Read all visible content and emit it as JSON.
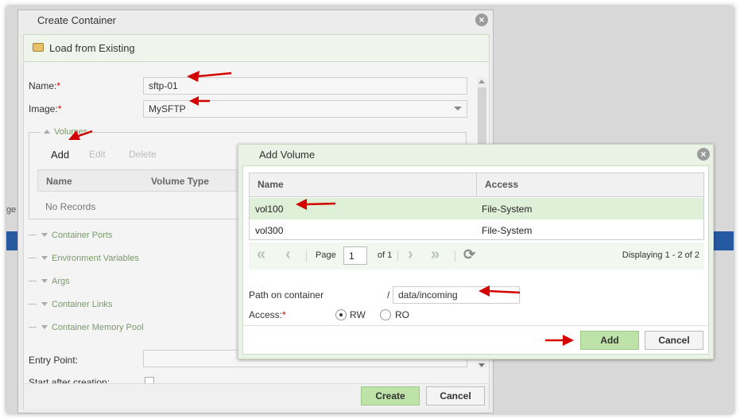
{
  "background": {
    "partial_label": "ge"
  },
  "create_dialog": {
    "title": "Create Container",
    "load_existing": "Load from Existing",
    "name_label": "Name:",
    "name_value": "sftp-01",
    "image_label": "Image:",
    "image_value": "MySFTP",
    "required_mark": "*",
    "volumes": {
      "legend": "Volumes",
      "toolbar": {
        "add": "Add",
        "edit": "Edit",
        "delete": "Delete"
      },
      "columns": [
        "Name",
        "Volume Type"
      ],
      "empty_text": "No Records"
    },
    "sections": [
      "Container Ports",
      "Environment Variables",
      "Args",
      "Container Links",
      "Container Memory Pool"
    ],
    "entry_point_label": "Entry Point:",
    "start_after_creation_label": "Start after creation:",
    "create_button": "Create",
    "cancel_button": "Cancel"
  },
  "add_volume_dialog": {
    "title": "Add Volume",
    "columns": {
      "name": "Name",
      "access": "Access"
    },
    "rows": [
      {
        "name": "vol100",
        "access": "File-System",
        "selected": true
      },
      {
        "name": "vol300",
        "access": "File-System",
        "selected": false
      }
    ],
    "pager": {
      "page_label": "Page",
      "page_value": "1",
      "of_label": "of 1",
      "displaying": "Displaying 1 - 2 of 2"
    },
    "path_label": "Path on container",
    "path_prefix": "/",
    "path_value": "data/incoming",
    "access_label": "Access:",
    "access_options": {
      "rw": "RW",
      "ro": "RO"
    },
    "access_selected": "RW",
    "add_button": "Add",
    "cancel_button": "Cancel"
  },
  "colors": {
    "accent_green": "#bde3a9",
    "selected_row": "#dff0d8",
    "annotation_arrow": "#d40000",
    "background_strip": "#26599f"
  }
}
